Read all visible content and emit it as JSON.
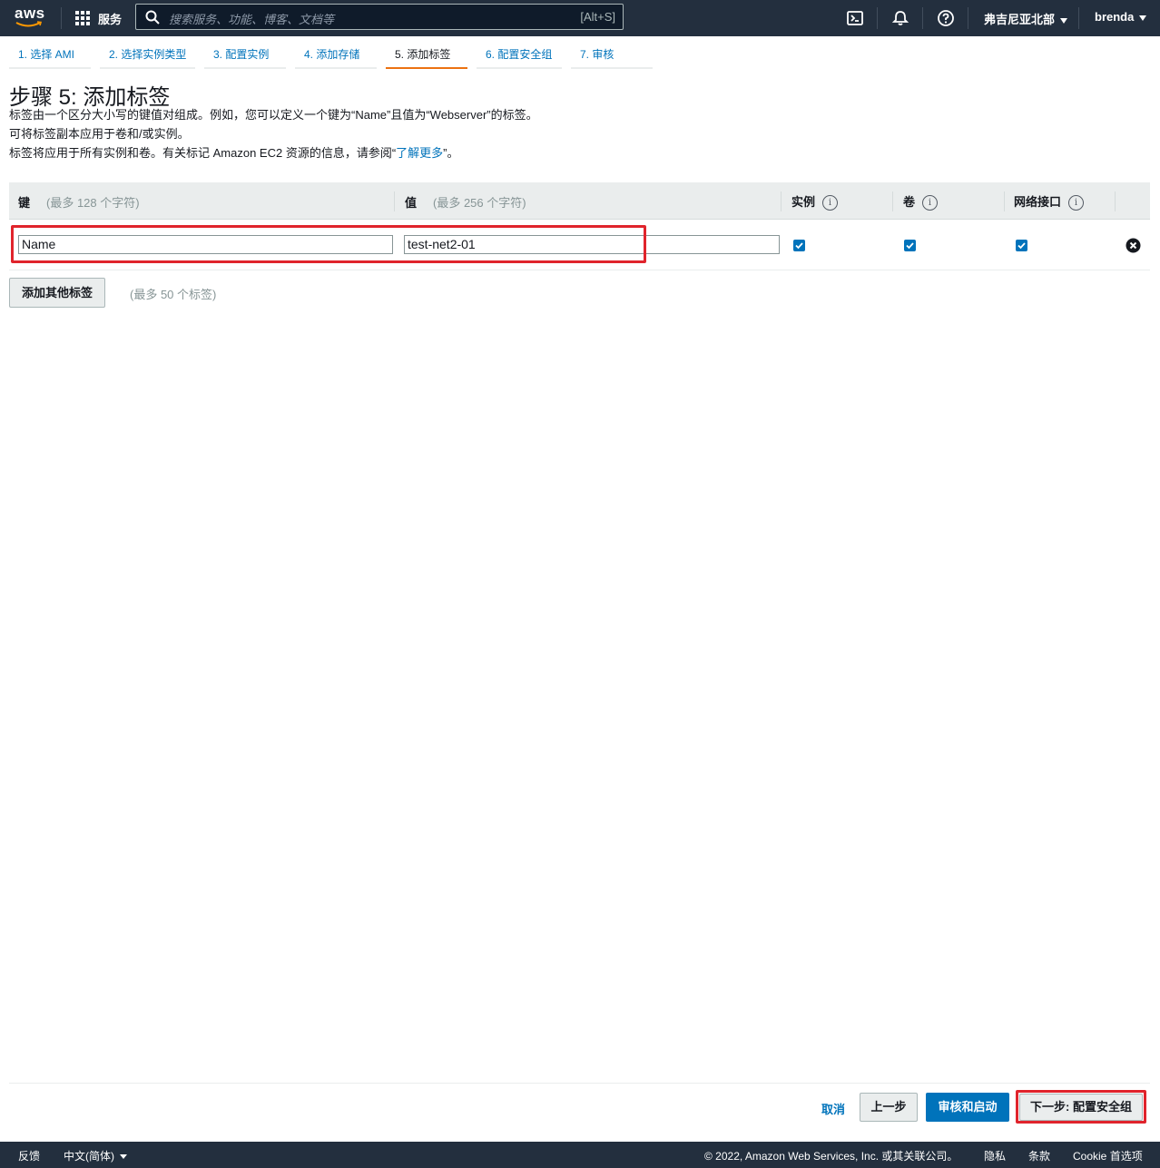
{
  "topnav": {
    "logo_text": "aws",
    "services_label": "服务",
    "search_placeholder": "搜索服务、功能、博客、文档等",
    "search_shortcut": "[Alt+S]",
    "region_label": "弗吉尼亚北部",
    "user_label": "brenda"
  },
  "steps": [
    {
      "label": "1. 选择 AMI",
      "active": false
    },
    {
      "label": "2. 选择实例类型",
      "active": false
    },
    {
      "label": "3. 配置实例",
      "active": false
    },
    {
      "label": "4. 添加存储",
      "active": false
    },
    {
      "label": "5. 添加标签",
      "active": true
    },
    {
      "label": "6. 配置安全组",
      "active": false
    },
    {
      "label": "7. 审核",
      "active": false
    }
  ],
  "page": {
    "title": "步骤 5: 添加标签",
    "desc1": "标签由一个区分大小写的键值对组成。例如，您可以定义一个键为“Name”且值为“Webserver”的标签。",
    "desc2": "可将标签副本应用于卷和/或实例。",
    "desc3_prefix": "标签将应用于所有实例和卷。有关标记 Amazon EC2 资源的信息，请参阅“",
    "desc3_link": "了解更多",
    "desc3_suffix": "”。"
  },
  "table": {
    "col_key": "键",
    "col_key_hint": "(最多 128 个字符)",
    "col_value": "值",
    "col_value_hint": "(最多 256 个字符)",
    "col_instance": "实例",
    "col_volume": "卷",
    "col_eni": "网络接口",
    "info_glyph": "i",
    "rows": [
      {
        "key": "Name",
        "value": "test-net2-01",
        "instance": true,
        "volume": true,
        "eni": true
      }
    ]
  },
  "actions": {
    "add_tag_label": "添加其他标签",
    "add_tag_hint": "(最多 50 个标签)",
    "cancel_label": "取消",
    "previous_label": "上一步",
    "review_launch_label": "审核和启动",
    "next_label": "下一步: 配置安全组"
  },
  "footer": {
    "feedback": "反馈",
    "language": "中文(简体)",
    "copyright": "© 2022, Amazon Web Services, Inc. 或其关联公司。",
    "privacy": "隐私",
    "terms": "条款",
    "cookie": "Cookie 首选项"
  },
  "colors": {
    "nav_bg": "#232f3e",
    "link": "#0073bb",
    "active_step": "#ec7211",
    "highlight": "#e0242c"
  }
}
